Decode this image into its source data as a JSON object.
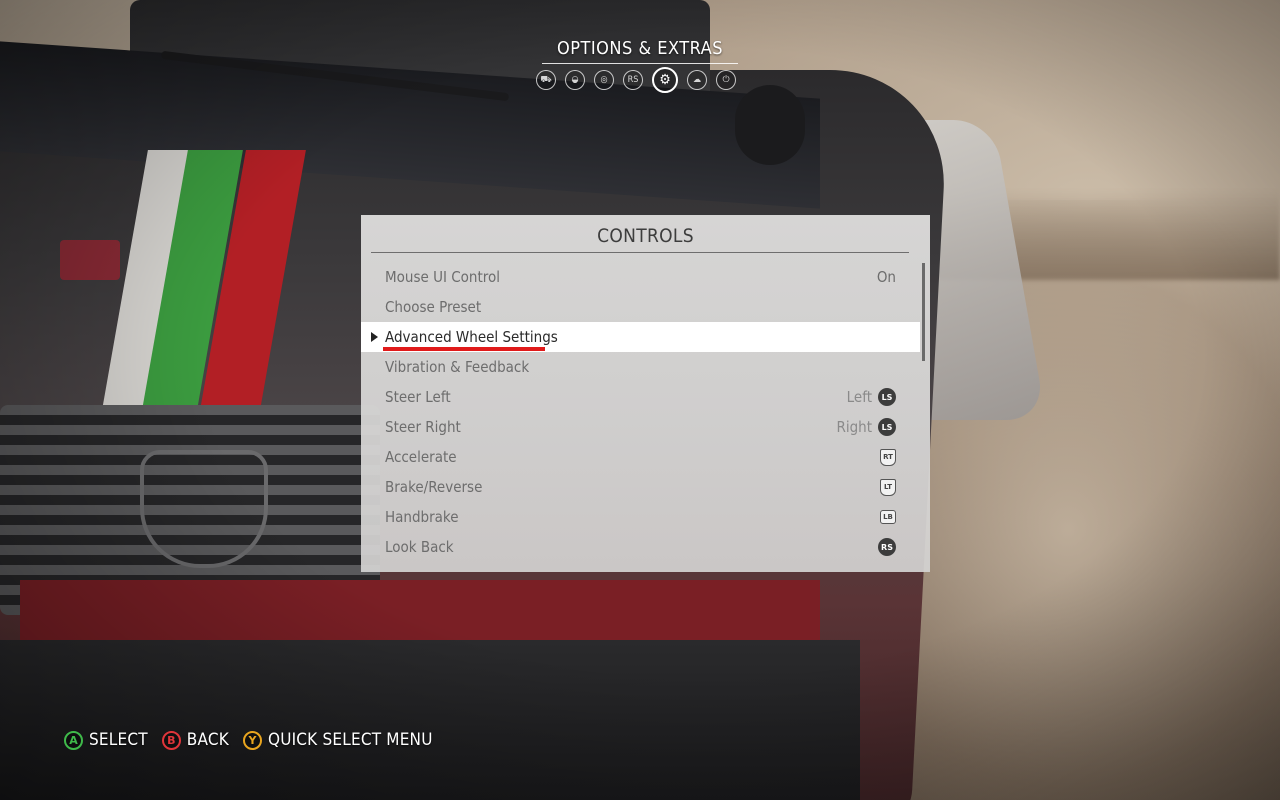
{
  "header": {
    "title": "OPTIONS & EXTRAS",
    "tabs": [
      {
        "icon": "car-icon",
        "glyph": "⛟",
        "active": false
      },
      {
        "icon": "helmet-icon",
        "glyph": "◒",
        "active": false
      },
      {
        "icon": "steering-wheel-icon",
        "glyph": "◎",
        "active": false
      },
      {
        "icon": "rs-badge-icon",
        "glyph": "RS",
        "active": false
      },
      {
        "icon": "gears-icon",
        "glyph": "⚙",
        "active": true
      },
      {
        "icon": "cloud-icon",
        "glyph": "☁",
        "active": false
      },
      {
        "icon": "power-icon",
        "glyph": "⏻",
        "active": false
      }
    ]
  },
  "panel": {
    "title": "CONTROLS",
    "items": [
      {
        "label": "Mouse UI Control",
        "value": "On",
        "button": ""
      },
      {
        "label": "Choose Preset",
        "value": "",
        "button": ""
      },
      {
        "label": "Advanced Wheel Settings",
        "value": "",
        "button": "",
        "selected": true
      },
      {
        "label": "Vibration & Feedback",
        "value": "",
        "button": ""
      },
      {
        "label": "Steer Left",
        "value": "Left",
        "button": "LS"
      },
      {
        "label": "Steer Right",
        "value": "Right",
        "button": "LS"
      },
      {
        "label": "Accelerate",
        "value": "",
        "button": "RT"
      },
      {
        "label": "Brake/Reverse",
        "value": "",
        "button": "LT"
      },
      {
        "label": "Handbrake",
        "value": "",
        "button": "LB"
      },
      {
        "label": "Look Back",
        "value": "",
        "button": "RS"
      }
    ]
  },
  "footer": {
    "hints": [
      {
        "button": "A",
        "label": "SELECT",
        "color": "#3fb94a"
      },
      {
        "button": "B",
        "label": "BACK",
        "color": "#e0353a"
      },
      {
        "button": "Y",
        "label": "QUICK SELECT MENU",
        "color": "#e9a51f"
      }
    ]
  },
  "colors": {
    "selection_underline": "#e01a1a",
    "panel_background": "#dfdedd"
  }
}
